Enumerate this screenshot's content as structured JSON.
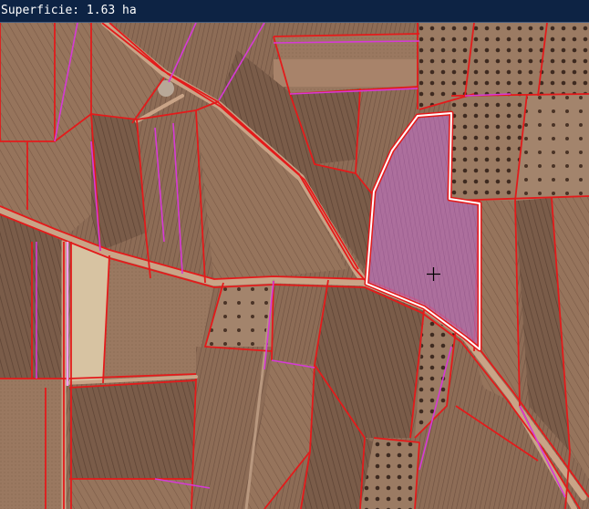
{
  "status": {
    "area_text": "Superficie: 1.63 ha"
  },
  "colors": {
    "parcel_border": "#e31b1b",
    "subparcel_border": "#d63ad6",
    "selection_fill": "#c06ad0",
    "selection_outline": "#ffffff",
    "road": "#c9a487",
    "field_dark": "#6b5242",
    "field_mid": "#8c6b55",
    "field_light": "#a88a72",
    "fallow": "#d7c3a2"
  },
  "map": {
    "selected_parcel": {
      "state": "selected",
      "cursor": "crosshair-icon"
    }
  }
}
